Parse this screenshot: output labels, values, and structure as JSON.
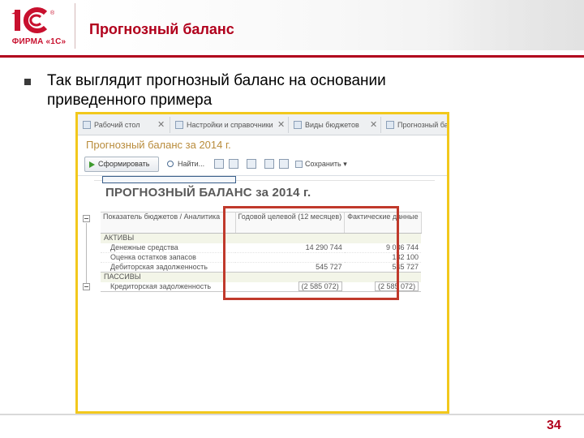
{
  "header": {
    "logo_text": "ФИРМА «1С»",
    "title": "Прогнозный баланс"
  },
  "bullet": {
    "text": "Так выглядит прогнозный баланс на основании приведенного примера"
  },
  "screenshot": {
    "tabs": [
      {
        "label": "Рабочий стол",
        "icon": "home-icon"
      },
      {
        "label": "Настройки и справочники",
        "icon": "settings-icon"
      },
      {
        "label": "Виды бюджетов",
        "icon": "list-icon"
      },
      {
        "label": "Прогнозный балан",
        "icon": "report-icon"
      }
    ],
    "report_title": "Прогнозный баланс за 2014 г.",
    "toolbar": {
      "generate_label": "Сформировать",
      "find_label": "Найти...",
      "more_label": "Сохранить"
    },
    "sheet": {
      "title": "ПРОГНОЗНЫЙ БАЛАНС  за 2014 г.",
      "columns": {
        "c1": "Показатель бюджетов / Аналитика",
        "c2": "Годовой целевой (12 месяцев)",
        "c3": "Фактические данные"
      },
      "rows": {
        "assets": "АКТИВЫ",
        "cash": {
          "label": "Денежные средства",
          "plan": "14 290 744",
          "fact": "9 036 744"
        },
        "inventory": {
          "label": "Оценка остатков запасов",
          "plan": "",
          "fact": "132 100"
        },
        "receivables": {
          "label": "Дебиторская задолженность",
          "plan": "545 727",
          "fact": "545 727"
        },
        "liabilities": "ПАССИВЫ",
        "payables": {
          "label": "Кредиторская задолженность",
          "plan": "(2 585 072)",
          "fact": "(2 585 072)"
        }
      }
    }
  },
  "page": {
    "number": "34"
  },
  "colors": {
    "brand_red": "#b1001c",
    "screenshot_frame": "#f2c81c",
    "highlight": "#c0392b"
  }
}
